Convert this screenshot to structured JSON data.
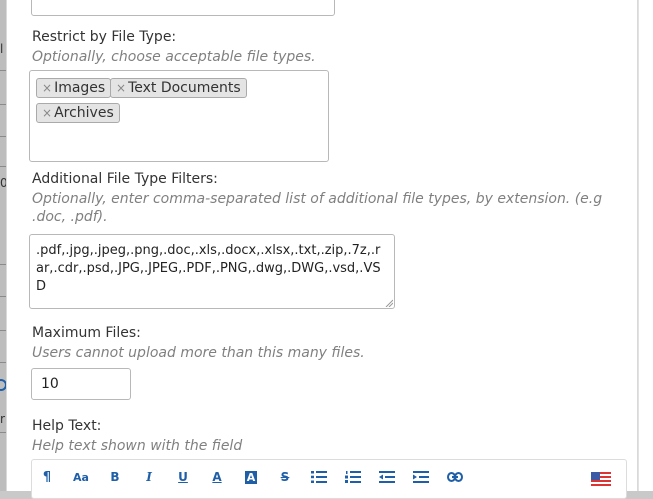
{
  "fields": {
    "restrict_file_type": {
      "label": "Restrict by File Type:",
      "hint": "Optionally, choose acceptable file types.",
      "tags": [
        {
          "label": "Images"
        },
        {
          "label": "Text Documents"
        },
        {
          "label": "Archives"
        }
      ],
      "remove_glyph": "×"
    },
    "additional_filters": {
      "label": "Additional File Type Filters:",
      "hint": "Optionally, enter comma-separated list of additional file types, by extension. (e.g .doc, .pdf).",
      "value": ".pdf,.jpg,.jpeg,.png,.doc,.xls,.docx,.xlsx,.txt,.zip,.7z,.rar,.cdr,.psd,.JPG,.JPEG,.PDF,.PNG,.dwg,.DWG,.vsd,.VSD"
    },
    "maximum_files": {
      "label": "Maximum Files:",
      "hint": "Users cannot upload more than this many files.",
      "value": "10"
    },
    "help_text": {
      "label": "Help Text:",
      "hint": "Help text shown with the field"
    }
  },
  "toolbar": {
    "paragraph_glyph": "¶",
    "font_size_glyph": "Aa",
    "bold_glyph": "B",
    "italic_glyph": "I",
    "underline_glyph": "U",
    "text_color_glyph": "A",
    "bg_color_glyph": "A",
    "strike_glyph": "S"
  },
  "backdrop": {
    "glyphs": [
      "l",
      "0",
      "r"
    ]
  },
  "colors": {
    "accent": "#1f5fa8",
    "hint": "#808080",
    "tag_bg": "#e4e4e4"
  }
}
